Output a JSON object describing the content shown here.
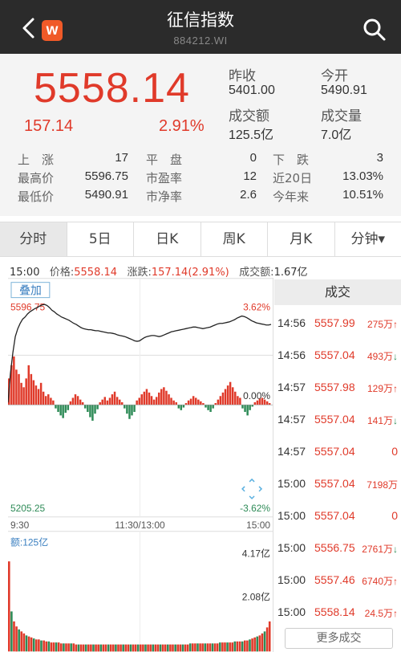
{
  "header": {
    "title": "征信指数",
    "code": "884212.WI",
    "logo_letter": "w"
  },
  "quote": {
    "price": "5558.14",
    "change": "157.14",
    "change_pct": "2.91%",
    "prev_close_label": "昨收",
    "prev_close": "5401.00",
    "open_label": "今开",
    "open": "5490.91",
    "amount_label": "成交额",
    "amount": "125.5亿",
    "volume_label": "成交量",
    "volume": "7.0亿"
  },
  "stats": {
    "up_label": "上　涨",
    "up": "17",
    "flat_label": "平　盘",
    "flat": "0",
    "down_label": "下　跌",
    "down": "3",
    "high_label": "最高价",
    "high": "5596.75",
    "pe_label": "市盈率",
    "pe": "12",
    "d20_label": "近20日",
    "d20": "13.03%",
    "low_label": "最低价",
    "low": "5490.91",
    "pb_label": "市净率",
    "pb": "2.6",
    "ytd_label": "今年来",
    "ytd": "10.51%"
  },
  "tabs": [
    "分时",
    "5日",
    "日K",
    "周K",
    "月K",
    "分钟▾"
  ],
  "info": {
    "time": "15:00",
    "price_label": "价格:",
    "price": "5558.14",
    "chg_label": "涨跌:",
    "chg": "157.14(2.91%)",
    "amt_label": "成交额:",
    "amt": "1.67亿"
  },
  "chart": {
    "add_label": "叠加",
    "top_left": "5596.75",
    "top_right": "3.62%",
    "mid_right": "0.00%",
    "bottom_left": "5205.25",
    "bottom_right": "-3.62%",
    "time_start": "9:30",
    "time_mid": "11:30/13:00",
    "time_end": "15:00",
    "vol_label": "额:125亿",
    "vol_top": "4.17亿",
    "vol_mid": "2.08亿"
  },
  "chart_data": {
    "type": "line",
    "ylim": [
      5205.25,
      5596.75
    ],
    "prev_close": 5401.0,
    "price_series": [
      5410,
      5465,
      5505,
      5535,
      5550,
      5560,
      5568,
      5572,
      5578,
      5582,
      5585,
      5588,
      5590,
      5593,
      5595,
      5596,
      5594,
      5590,
      5585,
      5582,
      5578,
      5575,
      5572,
      5570,
      5568,
      5566,
      5563,
      5560,
      5558,
      5555,
      5552,
      5550,
      5549,
      5548,
      5548,
      5547,
      5546,
      5546,
      5545,
      5544,
      5543,
      5542,
      5542,
      5541,
      5540,
      5538,
      5537,
      5536,
      5535,
      5533,
      5531,
      5529,
      5527,
      5526,
      5527,
      5530,
      5533,
      5535,
      5536,
      5537,
      5537,
      5536,
      5535,
      5536,
      5538,
      5540,
      5542,
      5544,
      5545,
      5546,
      5547,
      5548,
      5549,
      5550,
      5551,
      5552,
      5553,
      5553,
      5552,
      5551,
      5550,
      5551,
      5552,
      5553,
      5555,
      5557,
      5559,
      5560,
      5560,
      5561,
      5562,
      5563,
      5565,
      5567,
      5570,
      5572,
      5574,
      5573,
      5571,
      5568,
      5565,
      5563,
      5561,
      5560,
      5559,
      5558,
      5557,
      5557,
      5558
    ],
    "flow_series": [
      30,
      45,
      55,
      40,
      35,
      25,
      20,
      30,
      45,
      35,
      28,
      22,
      18,
      25,
      15,
      10,
      12,
      8,
      5,
      -4,
      -8,
      -12,
      -15,
      -9,
      -6,
      4,
      8,
      12,
      10,
      6,
      3,
      -4,
      -8,
      -14,
      -18,
      -10,
      -5,
      3,
      6,
      9,
      5,
      8,
      12,
      15,
      9,
      6,
      3,
      -4,
      -10,
      -16,
      -12,
      -8,
      5,
      8,
      12,
      15,
      18,
      14,
      10,
      6,
      9,
      14,
      18,
      20,
      16,
      12,
      8,
      5,
      3,
      -4,
      -6,
      -3,
      2,
      5,
      7,
      10,
      8,
      6,
      4,
      2,
      -3,
      -6,
      -8,
      -4,
      2,
      6,
      10,
      14,
      18,
      22,
      26,
      20,
      15,
      10,
      8,
      -4,
      -8,
      -12,
      -6,
      -2,
      3,
      5,
      7,
      8,
      6,
      4,
      2
    ],
    "volume_series": [
      90,
      40,
      30,
      25,
      22,
      20,
      18,
      16,
      15,
      14,
      13,
      12,
      12,
      11,
      11,
      10,
      10,
      9,
      9,
      9,
      9,
      8,
      8,
      8,
      8,
      8,
      8,
      7,
      7,
      7,
      7,
      7,
      7,
      7,
      7,
      7,
      7,
      7,
      7,
      7,
      7,
      7,
      7,
      7,
      7,
      7,
      7,
      7,
      7,
      7,
      7,
      7,
      7,
      7,
      7,
      7,
      7,
      7,
      7,
      7,
      7,
      7,
      7,
      7,
      7,
      7,
      7,
      7,
      7,
      7,
      7,
      7,
      7,
      8,
      8,
      8,
      8,
      8,
      8,
      8,
      8,
      8,
      8,
      8,
      8,
      9,
      9,
      9,
      9,
      9,
      9,
      10,
      10,
      10,
      10,
      11,
      11,
      12,
      13,
      14,
      15,
      16,
      18,
      20,
      24,
      30
    ]
  },
  "trades": {
    "header": "成交",
    "rows": [
      {
        "time": "14:56",
        "price": "5557.99",
        "vol": "275万",
        "arrow": "↑",
        "zero": false
      },
      {
        "time": "14:56",
        "price": "5557.04",
        "vol": "493万",
        "arrow": "↓",
        "zero": false
      },
      {
        "time": "14:57",
        "price": "5557.98",
        "vol": "129万",
        "arrow": "↑",
        "zero": false
      },
      {
        "time": "14:57",
        "price": "5557.04",
        "vol": "141万",
        "arrow": "↓",
        "zero": false
      },
      {
        "time": "14:57",
        "price": "5557.04",
        "vol": "0",
        "arrow": "",
        "zero": true
      },
      {
        "time": "15:00",
        "price": "5557.04",
        "vol": "7198万",
        "arrow": "",
        "zero": false
      },
      {
        "time": "15:00",
        "price": "5557.04",
        "vol": "0",
        "arrow": "",
        "zero": true
      },
      {
        "time": "15:00",
        "price": "5556.75",
        "vol": "2761万",
        "arrow": "↓",
        "zero": false
      },
      {
        "time": "15:00",
        "price": "5557.46",
        "vol": "6740万",
        "arrow": "↑",
        "zero": false
      },
      {
        "time": "15:00",
        "price": "5558.14",
        "vol": "24.5万",
        "arrow": "↑",
        "zero": false
      }
    ],
    "more_label": "更多成交"
  }
}
